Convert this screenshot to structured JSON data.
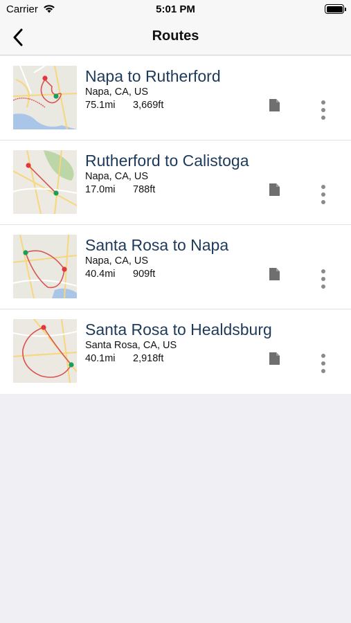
{
  "status_bar": {
    "carrier": "Carrier",
    "time": "5:01 PM",
    "icons": [
      "wifi-icon",
      "battery-icon"
    ]
  },
  "nav": {
    "title": "Routes",
    "back_icon": "chevron-left-icon"
  },
  "routes": [
    {
      "name": "Napa to Rutherford",
      "location": "Napa, CA, US",
      "distance": "75.1mi",
      "elevation": "3,669ft"
    },
    {
      "name": "Rutherford to Calistoga",
      "location": "Napa, CA, US",
      "distance": "17.0mi",
      "elevation": "788ft"
    },
    {
      "name": "Santa Rosa to Napa",
      "location": "Napa, CA, US",
      "distance": "40.4mi",
      "elevation": "909ft"
    },
    {
      "name": "Santa Rosa to Healdsburg",
      "location": "Santa Rosa, CA, US",
      "distance": "40.1mi",
      "elevation": "2,918ft"
    }
  ],
  "row_icons": {
    "document": "document-icon",
    "more": "more-vertical-icon"
  },
  "colors": {
    "route_title": "#1d3a5a",
    "start_pin": "#1a9e5c",
    "end_pin": "#e0383e",
    "route_line": "#d9534f",
    "background": "#efeff4"
  }
}
